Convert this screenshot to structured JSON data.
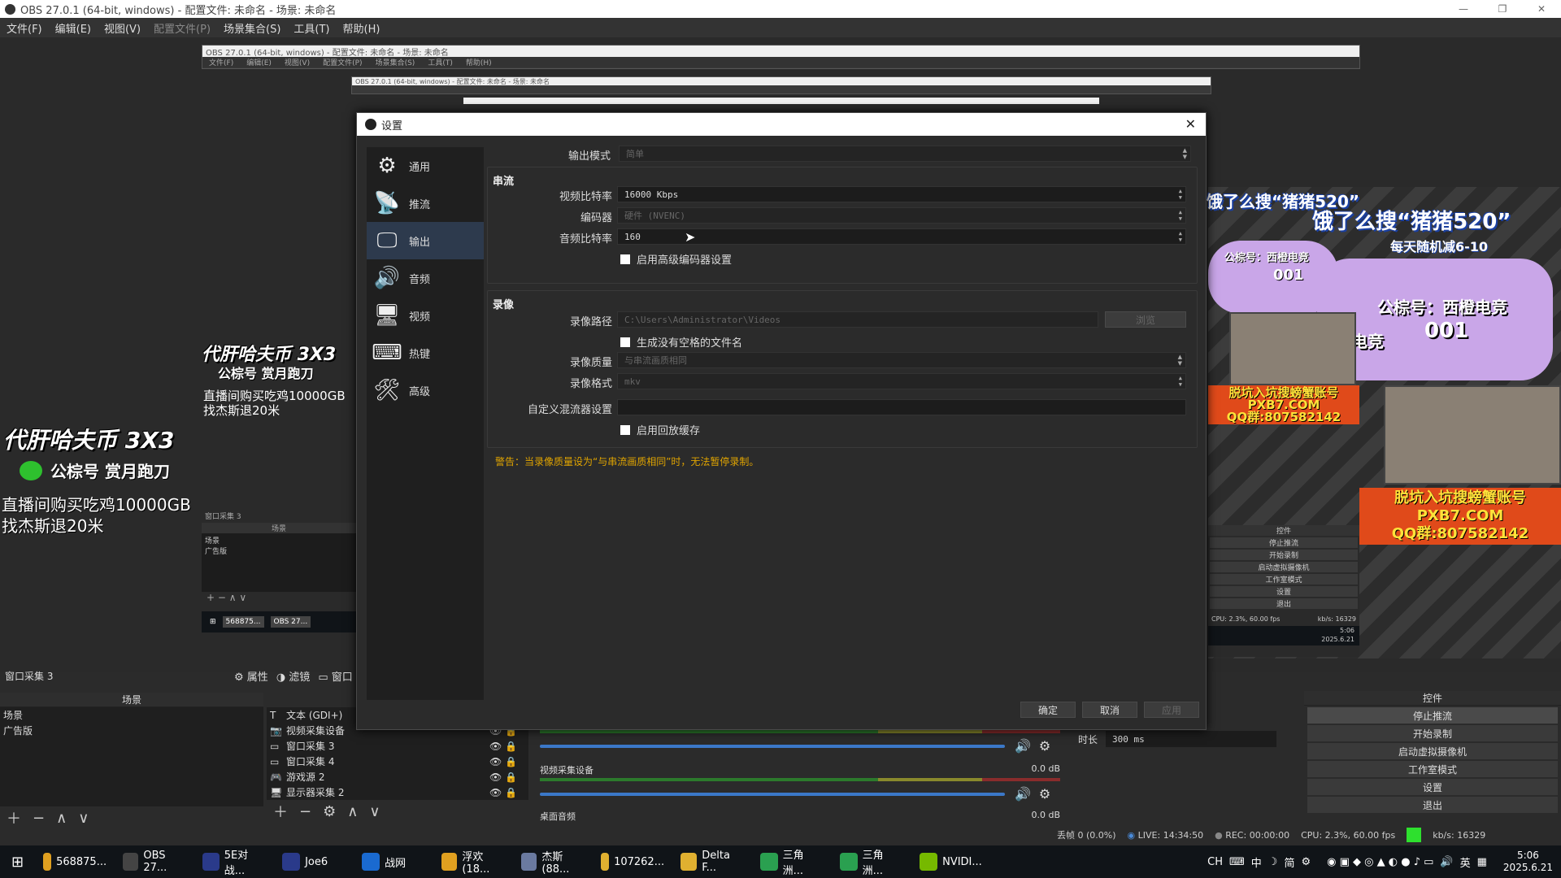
{
  "window": {
    "title": "OBS 27.0.1 (64-bit, windows) - 配置文件: 未命名 - 场景: 未命名",
    "controls": [
      "—",
      "❐",
      "✕"
    ]
  },
  "menu": {
    "items": [
      "文件(F)",
      "编辑(E)",
      "视图(V)",
      "配置文件(P)",
      "场景集合(S)",
      "工具(T)",
      "帮助(H)"
    ]
  },
  "nested": {
    "title1": "OBS 27.0.1 (64-bit, windows) - 配置文件: 未命名 - 场景: 未命名",
    "menu1": [
      "文件(F)",
      "编辑(E)",
      "视图(V)",
      "配置文件(P)",
      "场景集合(S)",
      "工具(T)",
      "帮助(H)"
    ],
    "title2": "OBS 27.0.1 (64-bit, windows) - 配置文件: 未命名 - 场景: 未命名",
    "inner_source": "窗口采集 3",
    "inner_scenes_header": "场景",
    "inner_scenes": [
      "场景",
      "广告版"
    ],
    "inner_taskbar": [
      "568875...",
      "OBS 27..."
    ]
  },
  "overlay": {
    "big_text": "代肝哈夫币 3X3",
    "wechat": "公棕号 赏月跑刀",
    "line1": "直播间购买吃鸡10000GB",
    "line2": "找杰斯退20米"
  },
  "stream": {
    "promo1": "饿了么搜“猪猪520”",
    "promo1_sub": "每天随机减6-10",
    "account": "公棕号：西橙电竞",
    "badge": "001",
    "brand": "西橙电竞",
    "pxb_line1": "脱坑入坑搜螃蟹账号",
    "pxb_line2": "PXB7.COM",
    "pxb_line3": "QQ群:807582142",
    "mini_controls": [
      "控件",
      "停止推流",
      "开始录制",
      "启动虚拟摄像机",
      "工作室模式",
      "设置",
      "退出"
    ],
    "mini_status": "CPU: 2.3%, 60.00 fps",
    "mini_kbs": "kb/s: 16329",
    "mini_clock_time": "5:06",
    "mini_clock_date": "2025.6.21"
  },
  "dialog": {
    "title": "设置",
    "nav": [
      {
        "label": "通用",
        "icon": "gear-icon",
        "glyph": "⚙"
      },
      {
        "label": "推流",
        "icon": "antenna-icon",
        "glyph": "📡"
      },
      {
        "label": "输出",
        "icon": "output-icon",
        "glyph": "🖵"
      },
      {
        "label": "音频",
        "icon": "speaker-icon",
        "glyph": "🔊"
      },
      {
        "label": "视频",
        "icon": "monitor-icon",
        "glyph": "🖥"
      },
      {
        "label": "热键",
        "icon": "keyboard-icon",
        "glyph": "⌨"
      },
      {
        "label": "高级",
        "icon": "tools-icon",
        "glyph": "🛠"
      }
    ],
    "output_mode_label": "输出模式",
    "output_mode_value": "简单",
    "streaming_title": "串流",
    "video_bitrate_label": "视频比特率",
    "video_bitrate_value": "16000 Kbps",
    "encoder_label": "编码器",
    "encoder_value": "硬件 (NVENC)",
    "audio_bitrate_label": "音频比特率",
    "audio_bitrate_value": "160",
    "adv_encoder_label": "启用高级编码器设置",
    "recording_title": "录像",
    "rec_path_label": "录像路径",
    "rec_path_value": "C:\\Users\\Administrator\\Videos",
    "browse_label": "浏览",
    "no_space_label": "生成没有空格的文件名",
    "rec_quality_label": "录像质量",
    "rec_quality_value": "与串流画质相同",
    "rec_format_label": "录像格式",
    "rec_format_value": "mkv",
    "muxer_label": "自定义混流器设置",
    "muxer_value": "",
    "replay_label": "启用回放缓存",
    "warning": "警告：当录像质量设为“与串流画质相同”时，无法暂停录制。",
    "ok": "确定",
    "cancel": "取消",
    "apply": "应用"
  },
  "docks": {
    "source_name": "窗口采集 3",
    "properties": "属性",
    "filters": "滤镜",
    "window_trunc": "窗口",
    "scenes_header": "场景",
    "scenes": [
      "场景",
      "广告版"
    ],
    "sources": [
      {
        "icon": "text-icon",
        "label": "文本 (GDI+)"
      },
      {
        "icon": "camera-icon",
        "label": "视频采集设备"
      },
      {
        "icon": "window-icon",
        "label": "窗口采集 3"
      },
      {
        "icon": "window-icon",
        "label": "窗口采集 4"
      },
      {
        "icon": "gamepad-icon",
        "label": "游戏源 2"
      },
      {
        "icon": "display-icon",
        "label": "显示器采集 2"
      }
    ],
    "mixer_tracks": [
      {
        "name": "视频采集设备",
        "db": "0.0 dB"
      },
      {
        "name": "桌面音频",
        "db": "0.0 dB"
      }
    ],
    "duration_label": "时长",
    "duration_value": "300 ms",
    "controls_header": "控件",
    "controls": [
      "停止推流",
      "开始录制",
      "启动虚拟摄像机",
      "工作室模式",
      "设置",
      "退出"
    ]
  },
  "status": {
    "dropped": "丢帧 0 (0.0%)",
    "live": "LIVE: 14:34:50",
    "rec": "REC: 00:00:00",
    "cpu": "CPU: 2.3%, 60.00 fps",
    "kbs": "kb/s: 16329"
  },
  "taskbar": {
    "items": [
      {
        "label": "568875...",
        "color": "#e0a020"
      },
      {
        "label": "OBS 27...",
        "color": "#444444"
      },
      {
        "label": "5E对战...",
        "color": "#2a3a8a"
      },
      {
        "label": "Joe6",
        "color": "#2a3a8a"
      },
      {
        "label": "战网",
        "color": "#1a6ad0"
      },
      {
        "label": "浮欢(18...",
        "color": "#e0a020"
      },
      {
        "label": "杰斯(88...",
        "color": "#6a7aa0"
      },
      {
        "label": "107262...",
        "color": "#e0b030"
      },
      {
        "label": "Delta F...",
        "color": "#e0b030"
      },
      {
        "label": "三角洲...",
        "color": "#2aa050"
      },
      {
        "label": "三角洲...",
        "color": "#2aa050"
      },
      {
        "label": "NVIDI...",
        "color": "#76b900"
      }
    ],
    "tray_text": "CH",
    "ime": "中",
    "ime2": "简",
    "lang": "英",
    "time": "5:06",
    "date": "2025.6.21"
  }
}
